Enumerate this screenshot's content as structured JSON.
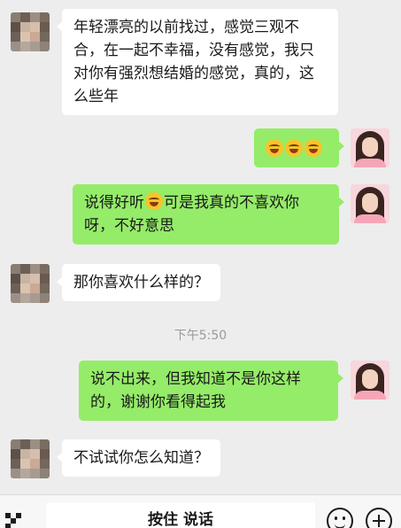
{
  "messages": [
    {
      "sender": "other",
      "text": "年轻漂亮的以前找过，感觉三观不合，在一起不幸福，没有感觉，我只对你有强烈想结婚的感觉，真的，这么些年"
    },
    {
      "sender": "me",
      "emoji": [
        "grinning-sweat-emoji",
        "grinning-sweat-emoji",
        "grinning-sweat-emoji"
      ]
    },
    {
      "sender": "me",
      "text_before": "说得好听",
      "emoji": "grinning-sweat-emoji",
      "text_after": "可是我真的不喜欢你呀，不好意思"
    },
    {
      "sender": "other",
      "text": "那你喜欢什么样的？"
    },
    {
      "sender": "me",
      "text": "说不出来，但我知道不是你这样的，谢谢你看得起我"
    },
    {
      "sender": "other",
      "text": "不试试你怎么知道？"
    }
  ],
  "timestamp": "下午5:50",
  "input_bar": {
    "hold_to_talk_label": "按住 说话",
    "left_icon": "voice-mode-icon",
    "emoji_icon": "emoji-icon",
    "more_icon": "plus-icon"
  },
  "colors": {
    "background": "#ededed",
    "bubble_self": "#95ec69",
    "bubble_other": "#ffffff",
    "timestamp_text": "#9a9a9a"
  }
}
